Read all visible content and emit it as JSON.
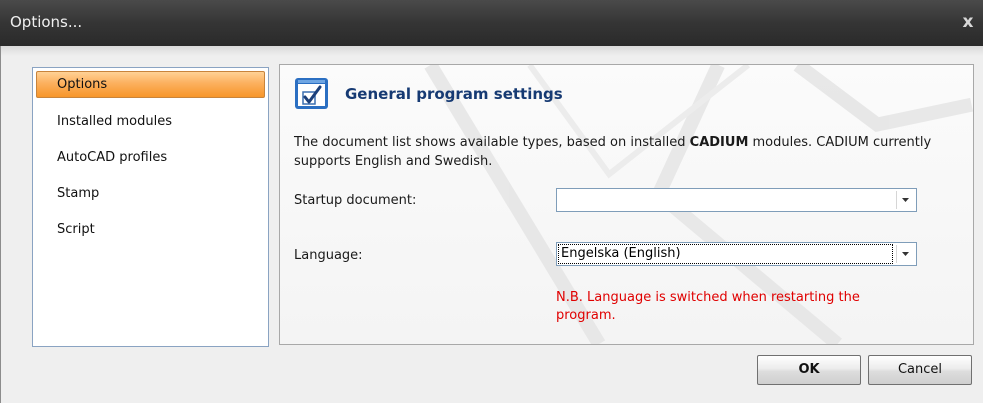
{
  "window": {
    "title": "Options...",
    "close_glyph": "x"
  },
  "sidebar": {
    "items": [
      {
        "label": "Options",
        "selected": true
      },
      {
        "label": "Installed modules",
        "selected": false
      },
      {
        "label": "AutoCAD profiles",
        "selected": false
      },
      {
        "label": "Stamp",
        "selected": false
      },
      {
        "label": "Script",
        "selected": false
      }
    ]
  },
  "panel": {
    "header_icon": "checkbox-window-icon",
    "title": "General program settings",
    "description_before": "The document list shows available types, based on installed ",
    "description_bold": "CADIUM",
    "description_after": " modules. CADIUM currently supports English and Swedish.",
    "startup_label": "Startup document:",
    "startup_value": "",
    "language_label": "Language:",
    "language_value": "Engelska (English)",
    "note": "N.B. Language is switched when restarting the program."
  },
  "buttons": {
    "ok_label": "OK",
    "cancel_label": "Cancel"
  },
  "colors": {
    "selected_item": "#fcb05e",
    "title_text": "#163a73",
    "note_text": "#e00000",
    "titlebar": "#353535"
  }
}
